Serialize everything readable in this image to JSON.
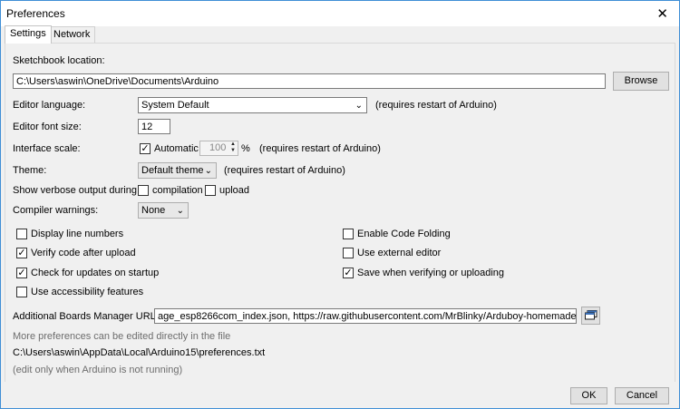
{
  "window": {
    "title": "Preferences"
  },
  "tabs": [
    {
      "label": "Settings"
    },
    {
      "label": "Network"
    }
  ],
  "sketchbook": {
    "label": "Sketchbook location:",
    "value": "C:\\Users\\aswin\\OneDrive\\Documents\\Arduino",
    "browse_label": "Browse"
  },
  "editor_language": {
    "label": "Editor language:",
    "value": "System Default",
    "note": "(requires restart of Arduino)"
  },
  "editor_font_size": {
    "label": "Editor font size:",
    "value": "12"
  },
  "interface_scale": {
    "label": "Interface scale:",
    "automatic_label": "Automatic",
    "automatic_checked": true,
    "value": "100",
    "unit": "%",
    "note": "(requires restart of Arduino)"
  },
  "theme": {
    "label": "Theme:",
    "value": "Default theme",
    "note": "(requires restart of Arduino)"
  },
  "verbose": {
    "label": "Show verbose output during:",
    "compilation_label": "compilation",
    "compilation_checked": false,
    "upload_label": "upload",
    "upload_checked": false
  },
  "compiler_warnings": {
    "label": "Compiler warnings:",
    "value": "None"
  },
  "options_left": [
    {
      "label": "Display line numbers",
      "checked": false
    },
    {
      "label": "Verify code after upload",
      "checked": true
    },
    {
      "label": "Check for updates on startup",
      "checked": true
    },
    {
      "label": "Use accessibility features",
      "checked": false
    }
  ],
  "options_right": [
    {
      "label": "Enable Code Folding",
      "checked": false
    },
    {
      "label": "Use external editor",
      "checked": false
    },
    {
      "label": "Save when verifying or uploading",
      "checked": true
    }
  ],
  "boards_manager": {
    "label": "Additional Boards Manager URLs:",
    "value": "age_esp8266com_index.json, https://raw.githubusercontent.com/MrBlinky/Arduboy-homemade-packag"
  },
  "footer_notes": {
    "more": "More preferences can be edited directly in the file",
    "path": "C:\\Users\\aswin\\AppData\\Local\\Arduino15\\preferences.txt",
    "edit_note": "(edit only when Arduino is not running)"
  },
  "buttons": {
    "ok": "OK",
    "cancel": "Cancel"
  },
  "check_mark": "✓",
  "chevron": "⌄",
  "close_glyph": "✕"
}
